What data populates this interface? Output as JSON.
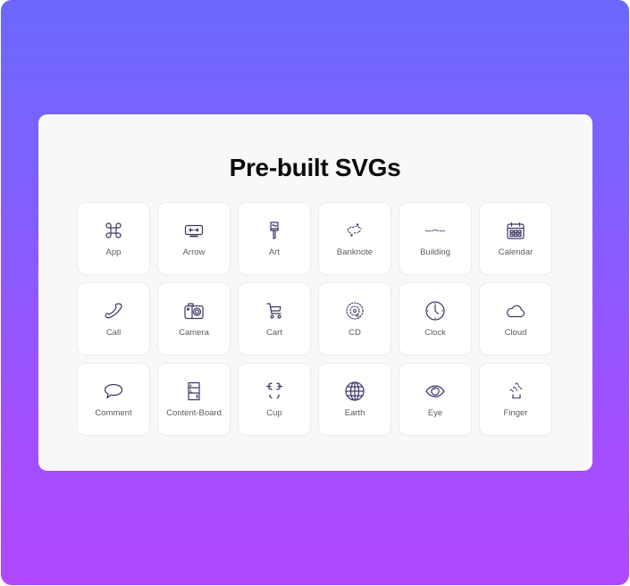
{
  "page": {
    "title": "Pre-built SVGs",
    "background_gradient": [
      "#6c68ff",
      "#b047ff"
    ],
    "card_color": "#f8f8f8",
    "icon_color": "#3d3764"
  },
  "icons": [
    {
      "label": "App",
      "icon": "app-icon"
    },
    {
      "label": "Arrow",
      "icon": "arrow-icon"
    },
    {
      "label": "Art",
      "icon": "art-icon"
    },
    {
      "label": "Banknote",
      "icon": "banknote-icon"
    },
    {
      "label": "Building",
      "icon": "building-icon"
    },
    {
      "label": "Calendar",
      "icon": "calendar-icon"
    },
    {
      "label": "Call",
      "icon": "call-icon"
    },
    {
      "label": "Camera",
      "icon": "camera-icon"
    },
    {
      "label": "Cart",
      "icon": "cart-icon"
    },
    {
      "label": "CD",
      "icon": "cd-icon"
    },
    {
      "label": "Clock",
      "icon": "clock-icon"
    },
    {
      "label": "Cloud",
      "icon": "cloud-icon"
    },
    {
      "label": "Comment",
      "icon": "comment-icon"
    },
    {
      "label": "Content-Board",
      "icon": "content-board-icon"
    },
    {
      "label": "Cup",
      "icon": "cup-icon"
    },
    {
      "label": "Earth",
      "icon": "earth-icon"
    },
    {
      "label": "Eye",
      "icon": "eye-icon"
    },
    {
      "label": "Finger",
      "icon": "finger-icon"
    }
  ]
}
